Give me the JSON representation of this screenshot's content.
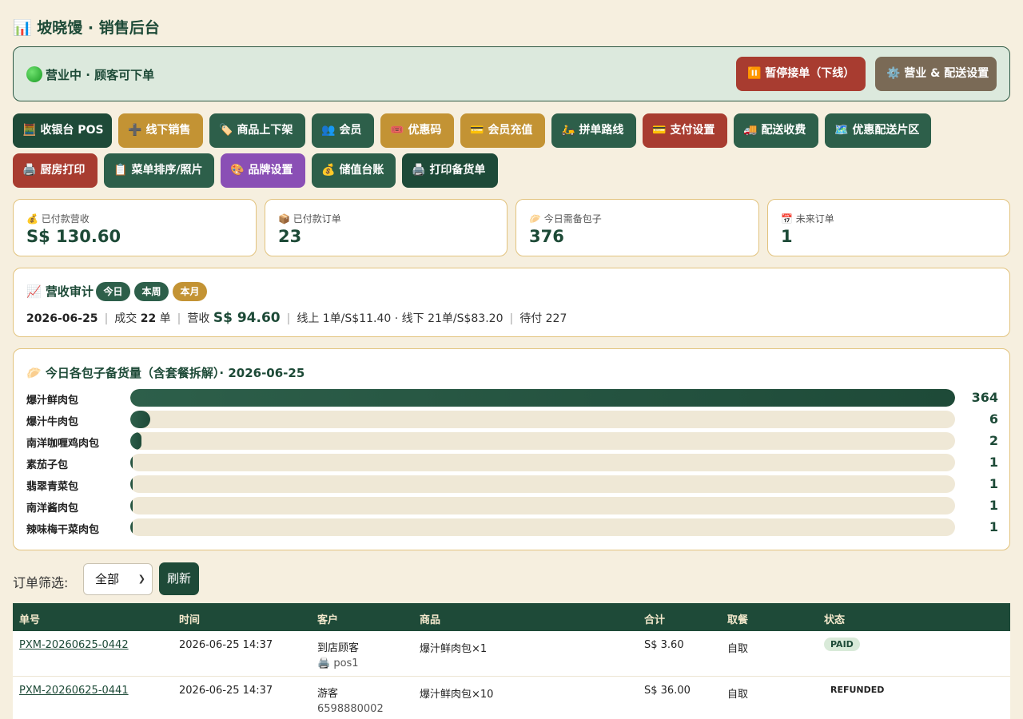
{
  "header": {
    "icon": "📊",
    "title": "坡晓馒 · 销售后台"
  },
  "status": {
    "text": "营业中 · 顾客可下单",
    "pause_label": "⏸️ 暂停接单（下线）",
    "settings_label": "⚙️ 营业 & 配送设置"
  },
  "nav": [
    {
      "icon": "🧮",
      "label": "收银台 POS"
    },
    {
      "icon": "➕",
      "label": "线下销售"
    },
    {
      "icon": "🏷️",
      "label": "商品上下架"
    },
    {
      "icon": "👥",
      "label": "会员"
    },
    {
      "icon": "🎟️",
      "label": "优惠码"
    },
    {
      "icon": "💳",
      "label": "会员充值"
    },
    {
      "icon": "🛵",
      "label": "拼单路线"
    },
    {
      "icon": "💳",
      "label": "支付设置"
    },
    {
      "icon": "🚚",
      "label": "配送收费"
    },
    {
      "icon": "🗺️",
      "label": "优惠配送片区"
    },
    {
      "icon": "🖨️",
      "label": "厨房打印"
    },
    {
      "icon": "📋",
      "label": "菜单排序/照片"
    },
    {
      "icon": "🎨",
      "label": "品牌设置"
    },
    {
      "icon": "💰",
      "label": "储值台账"
    },
    {
      "icon": "🖨️",
      "label": "打印备货单"
    }
  ],
  "stats": [
    {
      "label": "💰 已付款营收",
      "value": "S$ 130.60"
    },
    {
      "label": "📦 已付款订单",
      "value": "23"
    },
    {
      "label": "🥟 今日需备包子",
      "value": "376"
    },
    {
      "label": "📅 未来订单",
      "value": "1"
    }
  ],
  "audit": {
    "title": "📈 营收审计",
    "tabs": [
      "今日",
      "本周",
      "本月"
    ],
    "date": "2026-06-25",
    "deals_prefix": "成交",
    "deals_count": "22",
    "deals_suffix": "单",
    "revenue_prefix": "营收",
    "revenue": "S$ 94.60",
    "split": "线上 1单/S$11.40 · 线下 21单/S$83.20",
    "pending": "待付 227"
  },
  "stock": {
    "title": "🥟 今日各包子备货量（含套餐拆解）· 2026-06-25",
    "items": [
      {
        "name": "爆汁鲜肉包",
        "count": "364",
        "value": 364
      },
      {
        "name": "爆汁牛肉包",
        "count": "6",
        "value": 6
      },
      {
        "name": "南洋咖喱鸡肉包",
        "count": "2",
        "value": 2
      },
      {
        "name": "素茄子包",
        "count": "1",
        "value": 1
      },
      {
        "name": "翡翠青菜包",
        "count": "1",
        "value": 1
      },
      {
        "name": "南洋酱肉包",
        "count": "1",
        "value": 1
      },
      {
        "name": "辣味梅干菜肉包",
        "count": "1",
        "value": 1
      }
    ],
    "max": 364
  },
  "filter": {
    "label": "订单筛选:",
    "selected": "全部",
    "refresh": "刷新"
  },
  "table": {
    "headers": [
      "单号",
      "时间",
      "客户",
      "商品",
      "合计",
      "取餐",
      "状态"
    ],
    "rows": [
      {
        "id": "PXM-20260625-0442",
        "time": "2026-06-25 14:37",
        "customer": "到店顾客",
        "customer_sub": "🖨️ pos1",
        "items": "爆汁鲜肉包×1",
        "total": "S$ 3.60",
        "pickup": "自取",
        "status": "PAID"
      },
      {
        "id": "PXM-20260625-0441",
        "time": "2026-06-25 14:37",
        "customer": "游客",
        "customer_sub": "6598880002",
        "items": "爆汁鲜肉包×10",
        "total": "S$ 36.00",
        "pickup": "自取",
        "status": "REFUNDED"
      }
    ]
  }
}
